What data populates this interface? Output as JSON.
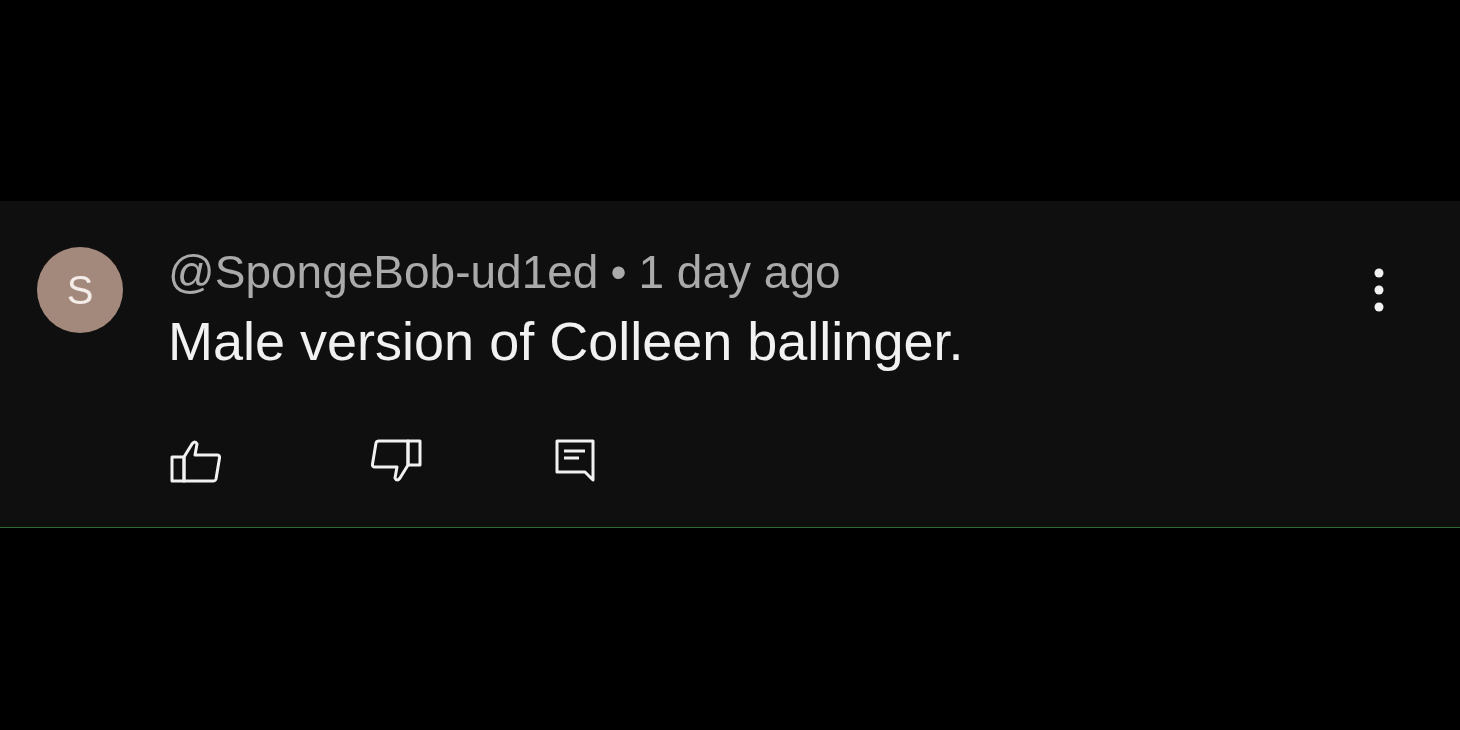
{
  "comment": {
    "avatar": {
      "initial": "S"
    },
    "author": "@SpongeBob-ud1ed",
    "separator": "•",
    "time": "1 day ago",
    "text": "Male version of Colleen ballinger.",
    "actions": [
      {
        "kind": "like"
      },
      {
        "kind": "dislike"
      },
      {
        "kind": "reply"
      }
    ]
  }
}
